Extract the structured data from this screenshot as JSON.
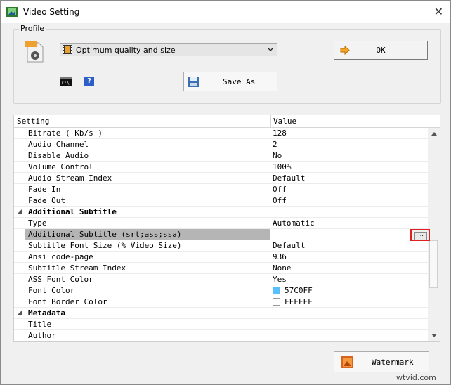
{
  "window": {
    "title": "Video Setting",
    "close_glyph": "✕"
  },
  "profile": {
    "label": "Profile",
    "selected": "Optimum quality and size",
    "ok_label": "OK",
    "save_as_label": "Save As",
    "help_glyph": "?"
  },
  "grid": {
    "header": {
      "setting": "Setting",
      "value": "Value"
    },
    "rows": [
      {
        "name": "Bitrate ( Kb/s )",
        "value": "128"
      },
      {
        "name": "Audio Channel",
        "value": "2"
      },
      {
        "name": "Disable Audio",
        "value": "No"
      },
      {
        "name": "Volume Control",
        "value": "100%"
      },
      {
        "name": "Audio Stream Index",
        "value": "Default"
      },
      {
        "name": "Fade In",
        "value": "Off"
      },
      {
        "name": "Fade Out",
        "value": "Off"
      }
    ],
    "cat_subtitle": "Additional Subtitle",
    "subtitle_rows": [
      {
        "name": "Type",
        "value": "Automatic"
      },
      {
        "name": "Additional Subtitle (srt;ass;ssa)",
        "value": ""
      },
      {
        "name": "Subtitle Font Size (% Video Size)",
        "value": "Default"
      },
      {
        "name": "Ansi code-page",
        "value": "936"
      },
      {
        "name": "Subtitle Stream Index",
        "value": "None"
      },
      {
        "name": "ASS Font Color",
        "value": "Yes"
      },
      {
        "name": "Font Color",
        "value": "57C0FF",
        "swatch": "#57c0ff"
      },
      {
        "name": "Font Border Color",
        "value": "FFFFFF",
        "swatch": "#ffffff"
      }
    ],
    "cat_metadata": "Metadata",
    "metadata_rows": [
      {
        "name": "Title",
        "value": ""
      },
      {
        "name": "Author",
        "value": ""
      }
    ],
    "browse_glyph": "..."
  },
  "watermark_label": "Watermark",
  "site_watermark": "wtvid.com",
  "colors": {
    "highlight": "#e01f1f",
    "selected_row": "#b5b5b5"
  }
}
